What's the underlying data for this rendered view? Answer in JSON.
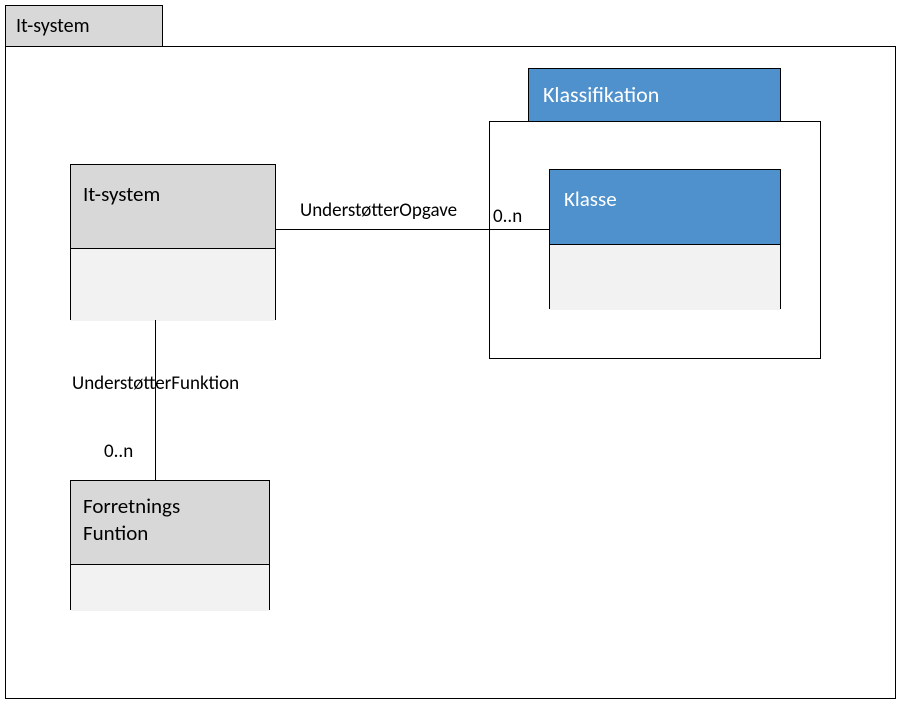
{
  "package": {
    "title": "It-system"
  },
  "entities": {
    "itsystem": {
      "name": "It-system"
    },
    "forretnings": {
      "name": "Forretnings\nFuntion"
    },
    "klassifikation": {
      "name": "Klassifikation"
    },
    "klasse": {
      "name": "Klasse"
    }
  },
  "relations": {
    "opgave": {
      "label": "UnderstøtterOpgave",
      "multiplicity": "0..n"
    },
    "funktion": {
      "label": "UnderstøtterFunktion",
      "multiplicity": "0..n"
    }
  }
}
